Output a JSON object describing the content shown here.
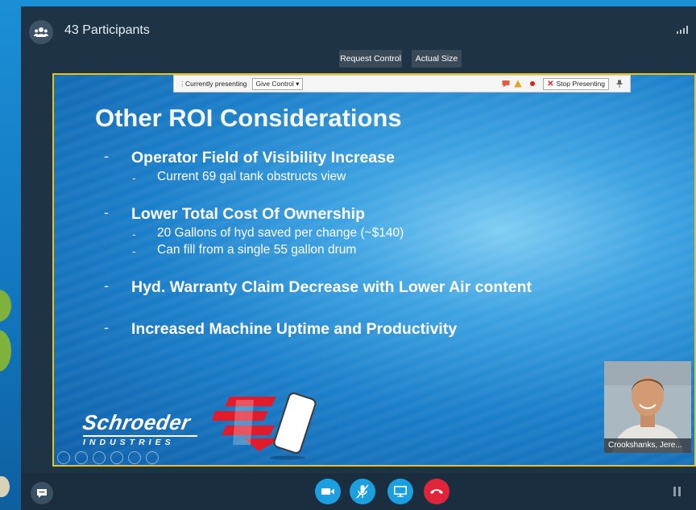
{
  "call": {
    "participants_label": "43 Participants",
    "request_control_label": "Request Control",
    "actual_size_label": "Actual Size"
  },
  "presenter_toolbar": {
    "status_label": "Currently presenting",
    "give_control_label": "Give Control",
    "stop_presenting_label": "Stop Presenting"
  },
  "slide": {
    "title": "Other ROI Considerations",
    "bullets": [
      {
        "text": "Operator Field of Visibility Increase",
        "subs": [
          "Current 69 gal tank obstructs view"
        ]
      },
      {
        "text": "Lower Total Cost Of Ownership",
        "subs": [
          "20 Gallons of hyd saved per change (~$140)",
          "Can fill from a single 55 gallon drum"
        ]
      },
      {
        "text": "Hyd. Warranty Claim Decrease with Lower Air content",
        "subs": []
      },
      {
        "text": "Increased Machine Uptime and Productivity",
        "subs": []
      }
    ],
    "dash": "-",
    "logo_name": "Schroeder",
    "logo_sub": "INDUSTRIES"
  },
  "video": {
    "name": "Crookshanks, Jere..."
  },
  "colors": {
    "share_border": "#e6c31e",
    "call_blue": "#1aa0e0",
    "hangup_red": "#e0243a"
  }
}
